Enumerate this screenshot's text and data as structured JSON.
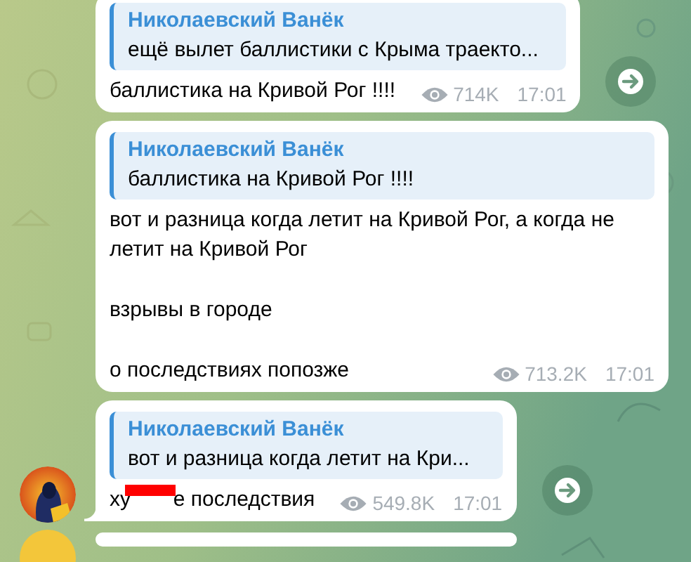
{
  "messages": [
    {
      "reply": {
        "author": "Николаевский Ванёк",
        "text": "ещё вылет баллистики с Крыма  траекто..."
      },
      "paragraphs": [
        "баллистика на Кривой Рог !!!!"
      ],
      "views": "714K",
      "time": "17:01",
      "avatar": false,
      "tail": false,
      "forward_button": true
    },
    {
      "reply": {
        "author": "Николаевский Ванёк",
        "text": "баллистика на Кривой Рог !!!!"
      },
      "paragraphs": [
        "вот и разница когда летит на Кривой Рог, а когда не летит на Кривой Рог",
        "взрывы в городе",
        "о последствиях попозже"
      ],
      "views": "713.2K",
      "time": "17:01",
      "avatar": false,
      "tail": false,
      "forward_button": false
    },
    {
      "reply": {
        "author": "Николаевский Ванёк",
        "text": "вот и разница когда летит на Кри..."
      },
      "paragraphs": [
        "ху"
      ],
      "redacted": true,
      "after_redaction": "е последствия",
      "views": "549.8K",
      "time": "17:01",
      "avatar": true,
      "tail": true,
      "forward_button": true
    }
  ]
}
